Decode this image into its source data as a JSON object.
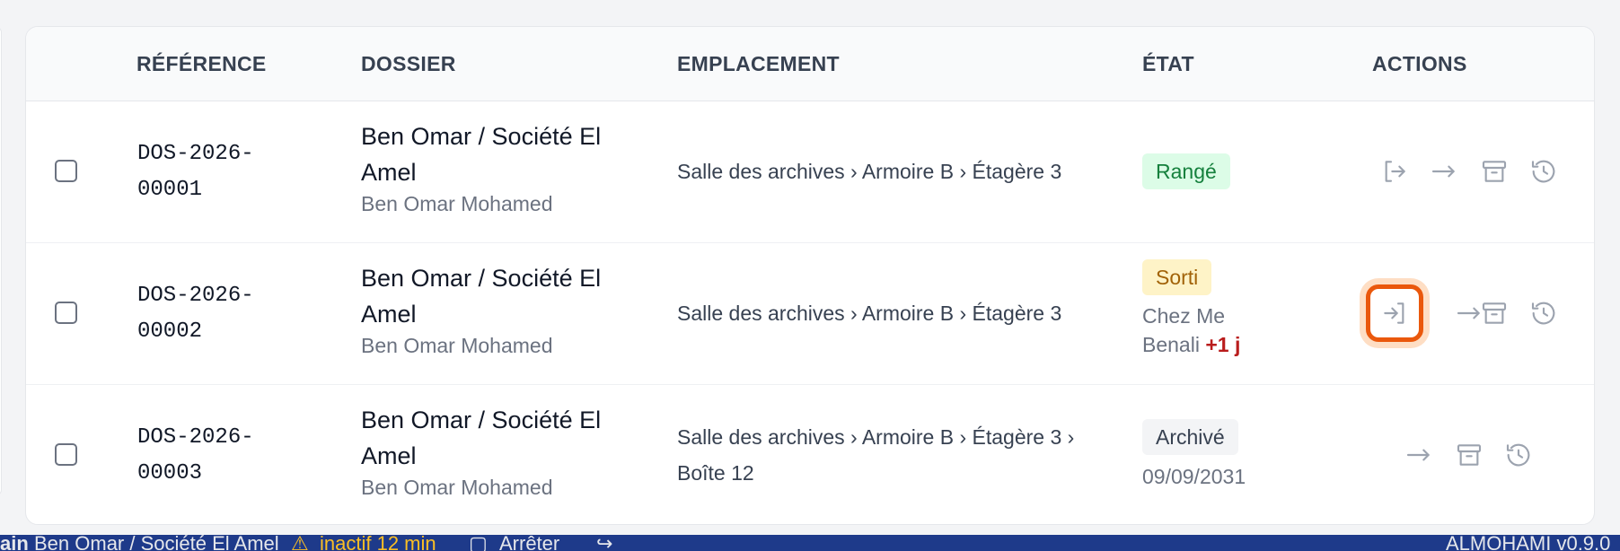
{
  "table": {
    "headers": {
      "ref": "RÉFÉRENCE",
      "dossier": "DOSSIER",
      "emplacement": "EMPLACEMENT",
      "etat": "ÉTAT",
      "actions": "ACTIONS"
    },
    "rows": [
      {
        "ref_line1": "DOS-2026-",
        "ref_line2": "00001",
        "dossier_title": "Ben Omar / Société El Amel",
        "dossier_client": "Ben Omar Mohamed",
        "location": "Salle des archives › Armoire B › Étagère 3",
        "state": "Rangé"
      },
      {
        "ref_line1": "DOS-2026-",
        "ref_line2": "00002",
        "dossier_title": "Ben Omar / Société El Amel",
        "dossier_client": "Ben Omar Mohamed",
        "location": "Salle des archives › Armoire B › Étagère 3",
        "state": "Sorti",
        "holder_line1": "Chez Me",
        "holder_line2": "Benali",
        "late": "+1 j"
      },
      {
        "ref_line1": "DOS-2026-",
        "ref_line2": "00003",
        "dossier_title": "Ben Omar / Société El Amel",
        "dossier_client": "Ben Omar Mohamed",
        "location": "Salle des archives › Armoire B › Étagère 3 › Boîte 12",
        "state": "Archivé",
        "state_date": "09/09/2031"
      }
    ]
  },
  "statusbar": {
    "prefix": "ain",
    "dossier": "Ben Omar / Société El Amel",
    "inactive": "inactif 12 min",
    "stop": "Arrêter",
    "version": "ALMOHAMI v0.9.0"
  },
  "icons": {
    "checkout": "box-arrow-out-icon",
    "checkin": "box-arrow-in-icon",
    "move": "arrow-right-icon",
    "archive": "archive-box-icon",
    "history": "history-clock-icon"
  },
  "colors": {
    "focus_ring": "#ea580c",
    "badge_green": "#15803d",
    "badge_yellow": "#a16207",
    "late": "#b91c1c",
    "statusbar": "#1e3a8a"
  }
}
